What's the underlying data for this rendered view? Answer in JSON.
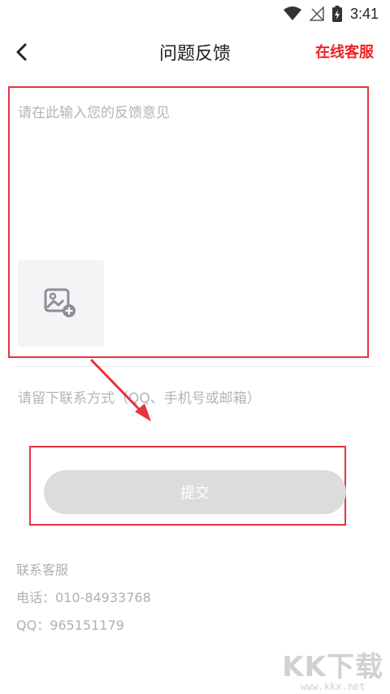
{
  "status_bar": {
    "time": "3:41",
    "icons": [
      "wifi-icon",
      "no-signal-icon",
      "battery-charging-icon"
    ]
  },
  "nav": {
    "title": "问题反馈",
    "online_service": "在线客服",
    "back_icon": "chevron-left-icon"
  },
  "feedback": {
    "placeholder": "请在此输入您的反馈意见",
    "add_image_icon": "image-add-icon"
  },
  "contact": {
    "placeholder": "请留下联系方式（QQ、手机号或邮箱）"
  },
  "submit": {
    "label": "提交"
  },
  "support_info": {
    "title": "联系客服",
    "phone": "电话：010-84933768",
    "qq": "QQ：965151179"
  },
  "watermark": {
    "brand": "KK下载",
    "url": "www.kkx.net"
  },
  "colors": {
    "accent_red": "#ee2222",
    "annotation_red": "#e5343f",
    "button_disabled": "#dcdcdc"
  }
}
